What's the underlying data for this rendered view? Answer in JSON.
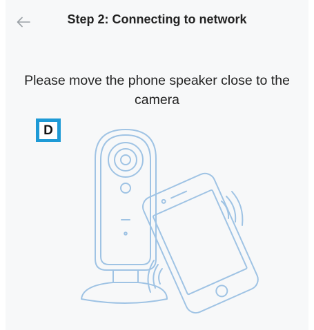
{
  "header": {
    "back_icon": "arrow-left-icon",
    "title": "Step 2: Connecting to network"
  },
  "main": {
    "instruction": "Please move the phone speaker close to the camera",
    "badge_label": "D",
    "illustration": {
      "subject": [
        "camera-icon",
        "phone-icon",
        "sound-waves-icon"
      ],
      "stroke_color": "#9fc3e4"
    }
  },
  "colors": {
    "background": "#f7f8f9",
    "text": "#222222",
    "badge_bg": "#1e9ad6",
    "badge_fg": "#ffffff"
  }
}
